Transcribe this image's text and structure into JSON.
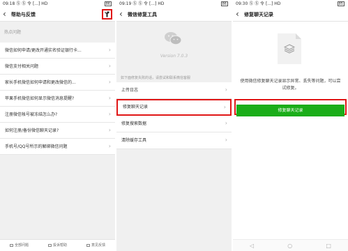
{
  "screen1": {
    "status": {
      "time": "09:18",
      "signals": "Ⓢ Ⓢ 令 [...] HD",
      "battery": "86"
    },
    "title": "帮助与反馈",
    "tools_icon": "wrench-icon",
    "section_label": "热点问题",
    "items": [
      "微信如何申请/更改开通实名验证银行卡...",
      "微信支付相关问题",
      "家长手机微信如何申请和更改微信的...",
      "苹果手机微信如何显示微信消息提醒?",
      "注册微信帐号被冻结怎么办?",
      "如何注册/备份微信聊天记录?",
      "手机号/QQ号所示的解绑微信问题"
    ],
    "bottom": [
      "全部问题",
      "投诉帮助",
      "意见反馈"
    ]
  },
  "screen2": {
    "status": {
      "time": "09:19",
      "signals": "Ⓢ Ⓢ 令 [...] HD",
      "battery": "86"
    },
    "title": "微信修复工具",
    "version": "Version 7.0.3",
    "hint": "如下面修复失败的话，请尝试和联系微信客服",
    "items": [
      "上传日志",
      "修复聊天记录",
      "修复搜索数据",
      "清除缓存工具"
    ]
  },
  "screen3": {
    "status": {
      "time": "09:30",
      "signals": "Ⓢ Ⓢ 令 [...] HD",
      "battery": "85"
    },
    "title": "修复聊天记录",
    "description": "使用微信修复聊天记录显示异常、丢失等问题，可以尝试修复。",
    "button": "修复聊天记录",
    "sysnav": [
      "◁",
      "○",
      "□"
    ]
  },
  "colors": {
    "accent_green": "#1aad19",
    "highlight_red": "#e01616"
  }
}
